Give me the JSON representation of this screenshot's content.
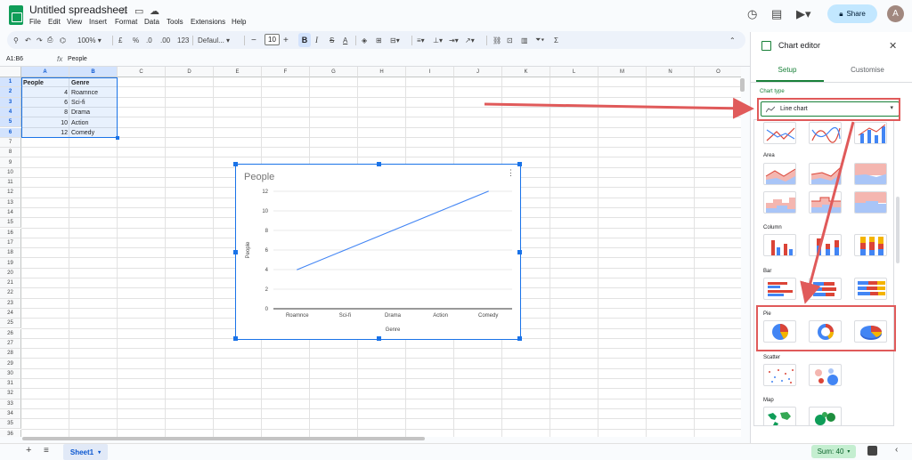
{
  "header": {
    "doc_title": "Untitled spreadsheet",
    "menu": [
      "File",
      "Edit",
      "View",
      "Insert",
      "Format",
      "Data",
      "Tools",
      "Extensions",
      "Help"
    ],
    "share_label": "Share",
    "avatar_initial": "A"
  },
  "toolbar": {
    "zoom": "100%",
    "currency": "£",
    "percent": "%",
    "decrease_decimal": ".0",
    "increase_decimal": ".00",
    "number_format": "123",
    "font": "Defaul...",
    "font_size": "10",
    "bold": "B",
    "italic": "I",
    "strike": "S",
    "text_color": "A",
    "sum": "Σ"
  },
  "formula_bar": {
    "name_box": "A1:B6",
    "fx": "fx",
    "value": "People"
  },
  "grid": {
    "columns": [
      "A",
      "B",
      "C",
      "D",
      "E",
      "F",
      "G",
      "H",
      "I",
      "J",
      "K",
      "L",
      "M",
      "N",
      "O"
    ],
    "rows": [
      "1",
      "2",
      "3",
      "4",
      "5",
      "6",
      "7",
      "8",
      "9",
      "10",
      "11",
      "12",
      "13",
      "14",
      "15",
      "16",
      "17",
      "18",
      "19",
      "20",
      "21",
      "22",
      "23",
      "24",
      "25",
      "26",
      "27",
      "28",
      "29",
      "30",
      "31",
      "32",
      "33",
      "34",
      "35",
      "36"
    ],
    "header_row": [
      "People",
      "Genre"
    ],
    "data_rows": [
      [
        "4",
        "Roamnce"
      ],
      [
        "6",
        "Sci-fi"
      ],
      [
        "8",
        "Drama"
      ],
      [
        "10",
        "Action"
      ],
      [
        "12",
        "Comedy"
      ]
    ]
  },
  "chart": {
    "menu_icon": "⋮"
  },
  "chart_data": {
    "type": "line",
    "title": "People",
    "xlabel": "Genre",
    "ylabel": "People",
    "categories": [
      "Roamnce",
      "Sci-fi",
      "Drama",
      "Action",
      "Comedy"
    ],
    "values": [
      4,
      6,
      8,
      10,
      12
    ],
    "yticks": [
      0,
      2,
      4,
      6,
      8,
      10,
      12
    ],
    "ylim": [
      0,
      12
    ],
    "grid": true,
    "legend": "none",
    "line_color": "#4285f4"
  },
  "bottom": {
    "add_sheet": "+",
    "all_sheets": "≡",
    "sheet_name": "Sheet1",
    "sum_label": "Sum: 40"
  },
  "editor": {
    "title": "Chart editor",
    "close": "✕",
    "tab_setup": "Setup",
    "tab_customise": "Customise",
    "chart_type_label": "Chart type",
    "chart_type_value": "Line chart",
    "sections": [
      "Area",
      "Column",
      "Bar",
      "Pie",
      "Scatter",
      "Map"
    ]
  },
  "colors": {
    "accent_green": "#188038",
    "selection_blue": "#1a73e8",
    "annotation_red": "#e05a5a",
    "chart_red": "#db4437",
    "chart_blue": "#4285f4",
    "chart_yellow": "#f4b400"
  }
}
